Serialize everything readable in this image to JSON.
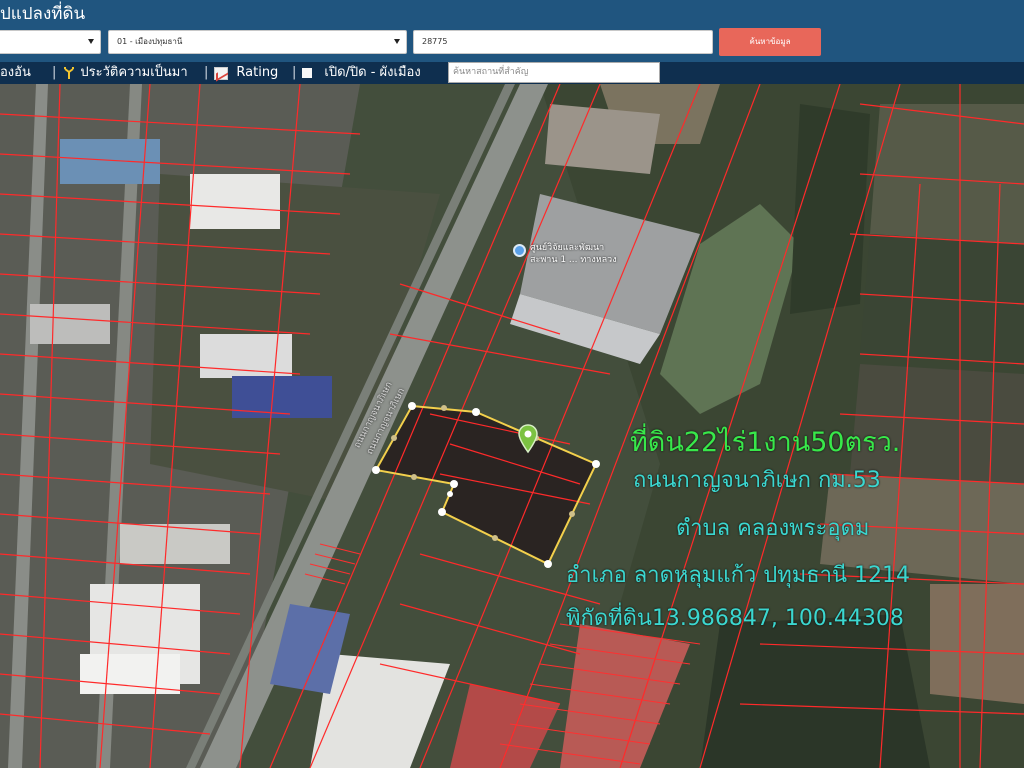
{
  "header": {
    "title": "ปแปลงที่ดิน",
    "province_select": "",
    "district_select": "01 - เมืองปทุมธานี",
    "parcel_number": "28775",
    "search_button": "ค้นหาข้อมูล"
  },
  "toolbar": {
    "item1": "องอัน",
    "history": "ประวัติความเป็นมา",
    "rating": "Rating",
    "toggle_layer": "เปิด/ปิด - ผังเมือง",
    "place_search_placeholder": "ค้นหาสถานที่สำคัญ"
  },
  "map": {
    "poi_line1": "ศูนย์วิจัยและพัฒนา",
    "poi_line2": "สะพาน 1 ... ทางหลวง",
    "road_line1": "ถนนกาญจนาภิเษก",
    "road_line2": "ถนนกาญจนาภิเษก",
    "colors": {
      "parcel_line": "#ff2a2a",
      "selected_outline": "#f3d04c",
      "title_text": "#38e84a",
      "info_text": "#3bd7d0"
    }
  },
  "info": {
    "title": "ที่ดิน22ไร่1งาน50ตรว.",
    "road": "ถนนกาญจนาภิเษก กม.53",
    "subdistrict": "ตำบล คลองพระอุดม",
    "district": "อำเภอ ลาดหลุมแก้ว ปทุมธานี 1214",
    "coords": "พิกัดที่ดิน13.986847, 100.44308"
  }
}
